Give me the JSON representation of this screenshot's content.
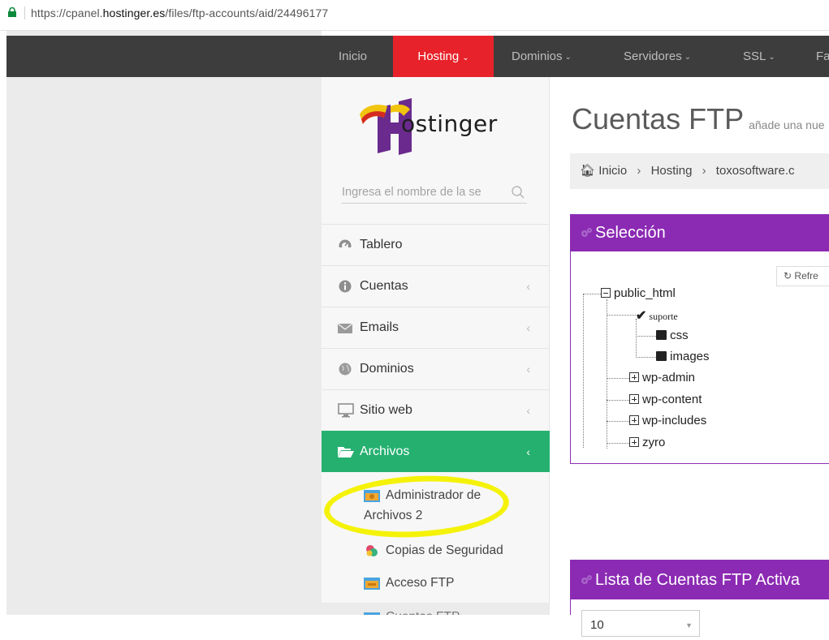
{
  "browser": {
    "url_prefix": "https://cpanel.",
    "url_domain": "hostinger.es",
    "url_path": "/files/ftp-accounts/aid/24496177"
  },
  "nav": {
    "items": [
      "Inicio",
      "Hosting",
      "Dominios",
      "Servidores",
      "SSL",
      "Fa"
    ],
    "active": "Hosting"
  },
  "logo": {
    "text": "ostinger"
  },
  "search": {
    "placeholder": "Ingresa el nombre de la se"
  },
  "menu": {
    "items": [
      {
        "label": "Tablero",
        "icon": "dashboard-icon"
      },
      {
        "label": "Cuentas",
        "icon": "info-icon"
      },
      {
        "label": "Emails",
        "icon": "envelope-icon"
      },
      {
        "label": "Dominios",
        "icon": "globe-icon"
      },
      {
        "label": "Sitio web",
        "icon": "monitor-icon"
      },
      {
        "label": "Archivos",
        "icon": "folder-open-icon"
      }
    ],
    "archivos_sub": [
      {
        "label": "Administrador de"
      },
      {
        "label": "Archivos 2"
      },
      {
        "label": "Copias de Seguridad"
      },
      {
        "label": "Acceso FTP"
      },
      {
        "label": "Cuentas FTP"
      }
    ]
  },
  "page": {
    "title": "Cuentas FTP",
    "subtitle": "añade una nue"
  },
  "breadcrumb": [
    "Inicio",
    "Hosting",
    "toxosoftware.c"
  ],
  "selection_panel": {
    "title": "Selección",
    "refresh_label": "Refre",
    "tree": {
      "root": "public_html",
      "selected": "suporte",
      "children_selected": [
        "css",
        "images"
      ],
      "folders": [
        "wp-admin",
        "wp-content",
        "wp-includes",
        "zyro"
      ]
    }
  },
  "list_panel": {
    "title": "Lista de Cuentas FTP Activa",
    "page_size": "10"
  },
  "colors": {
    "nav_bg": "#3d3d3d",
    "nav_active": "#e8222a",
    "menu_active": "#25b070",
    "panel_purple": "#8b2ab3",
    "highlight": "#f5f20a"
  }
}
